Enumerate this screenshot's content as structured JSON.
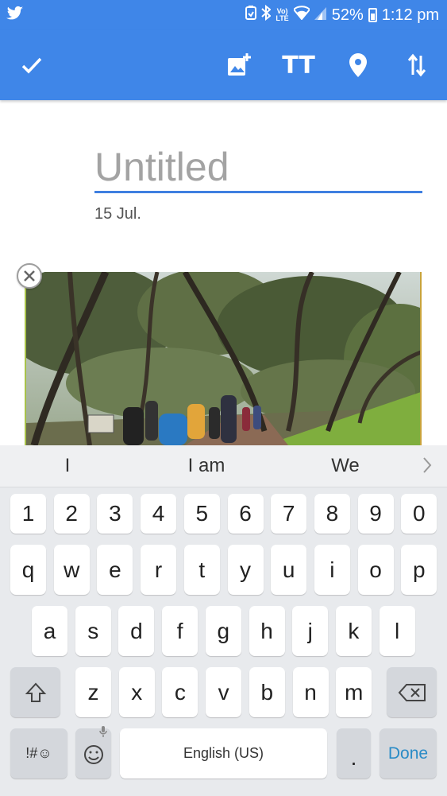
{
  "status_bar": {
    "app_icon": "twitter-icon",
    "network_label_top": "Vo)",
    "network_label_bottom": "LTE",
    "battery": "52%",
    "time": "1:12 pm"
  },
  "toolbar": {
    "confirm_icon": "check-icon",
    "add_image_icon": "add-image-icon",
    "text_format_label": "TT",
    "location_icon": "location-pin-icon",
    "sort_icon": "swap-vertical-icon"
  },
  "note": {
    "title_placeholder": "Untitled",
    "title_value": "",
    "date": "15 Jul.",
    "photo_remove_icon": "close-icon"
  },
  "keyboard": {
    "suggestions": [
      "I",
      "I am",
      "We"
    ],
    "number_row": [
      "1",
      "2",
      "3",
      "4",
      "5",
      "6",
      "7",
      "8",
      "9",
      "0"
    ],
    "row1": [
      "q",
      "w",
      "e",
      "r",
      "t",
      "y",
      "u",
      "i",
      "o",
      "p"
    ],
    "row2": [
      "a",
      "s",
      "d",
      "f",
      "g",
      "h",
      "j",
      "k",
      "l"
    ],
    "row3": [
      "z",
      "x",
      "c",
      "v",
      "b",
      "n",
      "m"
    ],
    "symbols_label": "!#☺",
    "space_label": "English (US)",
    "period_label": ".",
    "done_label": "Done"
  }
}
